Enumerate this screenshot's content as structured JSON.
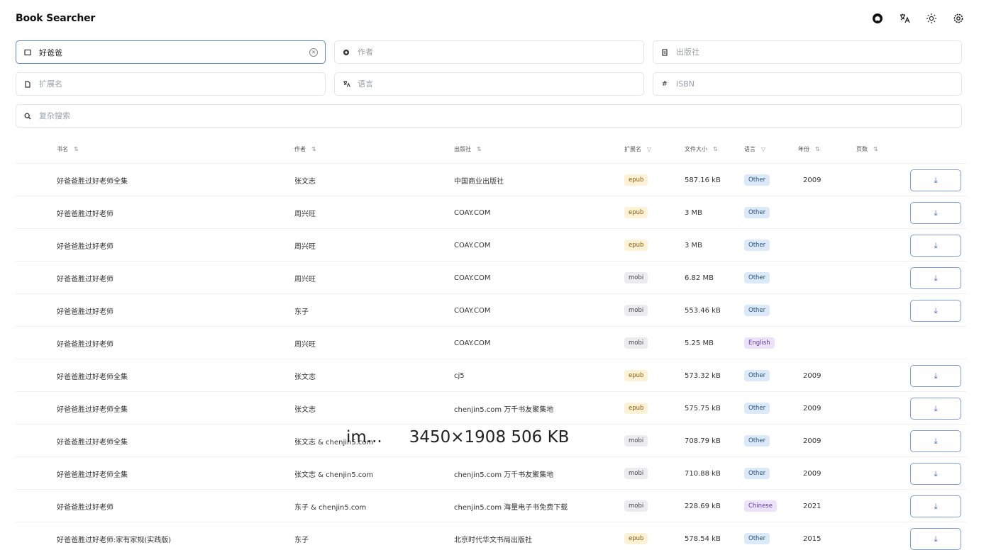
{
  "header": {
    "title": "Book Searcher",
    "icons": [
      "github-icon",
      "translate-icon",
      "theme-toggle-icon",
      "settings-icon"
    ]
  },
  "search": {
    "title": {
      "value": "好爸爸",
      "placeholder": ""
    },
    "author": {
      "placeholder": "作者"
    },
    "publisher": {
      "placeholder": "出版社"
    },
    "extension": {
      "placeholder": "扩展名"
    },
    "language": {
      "placeholder": "语言"
    },
    "isbn": {
      "placeholder": "ISBN"
    },
    "complex": {
      "placeholder": "复杂搜索"
    }
  },
  "table": {
    "columns": {
      "title": "书名",
      "author": "作者",
      "publisher": "出版社",
      "extension": "扩展名",
      "filesize": "文件大小",
      "language": "语言",
      "year": "年份",
      "pages": "页数"
    },
    "download_label": "⤓",
    "rows": [
      {
        "title": "好爸爸胜过好老师全集",
        "author": "张文志",
        "publisher": "中国商业出版社",
        "ext": "epub",
        "size": "587.16 kB",
        "lang": "Other",
        "year": "2009",
        "download": true
      },
      {
        "title": "好爸爸胜过好老师",
        "author": "周兴旺",
        "publisher": "COAY.COM",
        "ext": "epub",
        "size": "3 MB",
        "lang": "Other",
        "year": "",
        "download": true
      },
      {
        "title": "好爸爸胜过好老师",
        "author": "周兴旺",
        "publisher": "COAY.COM",
        "ext": "epub",
        "size": "3 MB",
        "lang": "Other",
        "year": "",
        "download": true
      },
      {
        "title": "好爸爸胜过好老师",
        "author": "周兴旺",
        "publisher": "COAY.COM",
        "ext": "mobi",
        "size": "6.82 MB",
        "lang": "Other",
        "year": "",
        "download": true
      },
      {
        "title": "好爸爸胜过好老师",
        "author": "东子",
        "publisher": "COAY.COM",
        "ext": "mobi",
        "size": "553.46 kB",
        "lang": "Other",
        "year": "",
        "download": true
      },
      {
        "title": "好爸爸胜过好老师",
        "author": "周兴旺",
        "publisher": "COAY.COM",
        "ext": "mobi",
        "size": "5.25 MB",
        "lang": "English",
        "year": "",
        "download": false
      },
      {
        "title": "好爸爸胜过好老师全集",
        "author": "张文志",
        "publisher": "cj5",
        "ext": "epub",
        "size": "573.32 kB",
        "lang": "Other",
        "year": "2009",
        "download": true
      },
      {
        "title": "好爸爸胜过好老师全集",
        "author": "张文志",
        "publisher": "chenjin5.com 万千书友聚集地",
        "ext": "epub",
        "size": "575.75 kB",
        "lang": "Other",
        "year": "2009",
        "download": true
      },
      {
        "title": "好爸爸胜过好老师全集",
        "author": "张文志 & chenjin5.com",
        "publisher": "",
        "ext": "mobi",
        "size": "708.79 kB",
        "lang": "Other",
        "year": "2009",
        "download": true
      },
      {
        "title": "好爸爸胜过好老师全集",
        "author": "张文志 & chenjin5.com",
        "publisher": "chenjin5.com 万千书友聚集地",
        "ext": "mobi",
        "size": "710.88 kB",
        "lang": "Other",
        "year": "2009",
        "download": true
      },
      {
        "title": "好爸爸胜过好老师",
        "author": "东子 & chenjin5.com",
        "publisher": "chenjin5.com 海量电子书免费下载",
        "ext": "mobi",
        "size": "228.69 kB",
        "lang": "Chinese",
        "year": "2021",
        "download": true
      },
      {
        "title": "好爸爸胜过好老师:家有家规(实践版)",
        "author": "东子",
        "publisher": "北京时代华文书局出版社",
        "ext": "epub",
        "size": "578.54 kB",
        "lang": "Other",
        "year": "2015",
        "download": true
      }
    ]
  },
  "overlay": {
    "name": "im...",
    "dims": "3450×1908 506 KB"
  }
}
